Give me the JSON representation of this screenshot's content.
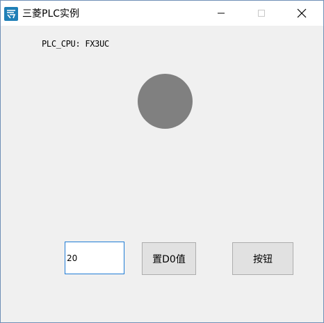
{
  "window": {
    "title": "三菱PLC实例",
    "icon": "app-logo-icon",
    "controls": {
      "minimize": "minimize-icon",
      "maximize": "maximize-icon",
      "close": "close-icon"
    }
  },
  "main": {
    "cpu_label": "PLC_CPU: FX3UC",
    "indicator_color": "#808080",
    "value_input": {
      "value": "20"
    },
    "set_d0_button": "置D0值",
    "generic_button": "按钮"
  }
}
